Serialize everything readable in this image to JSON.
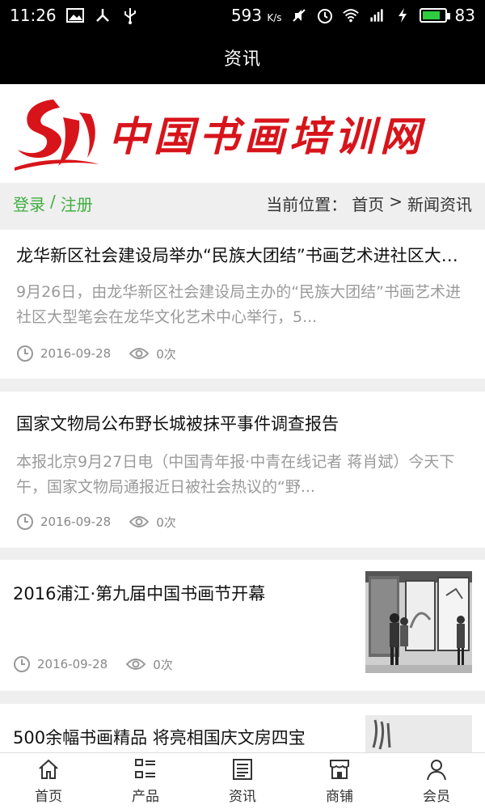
{
  "status_bar": {
    "time": "11:26",
    "network_speed": "593",
    "network_speed_unit": "K/s",
    "battery_level": "83",
    "battery_fraction": 0.83,
    "icons": [
      "image-icon",
      "share-icon",
      "usb-icon",
      "mute-icon",
      "alarm-icon",
      "wifi-icon",
      "signal-4g-icon",
      "charging-icon",
      "battery-icon"
    ]
  },
  "header": {
    "title": "资讯"
  },
  "banner": {
    "title": "中国书画培训网"
  },
  "auth": {
    "login": "登录",
    "separator": "/",
    "register": "注册"
  },
  "breadcrumb": {
    "label": "当前位置：",
    "home": "首页",
    "separator": ">",
    "current": "新闻资讯"
  },
  "articles": [
    {
      "title": "龙华新区社会建设局举办“民族大团结”书画艺术进社区大型笔会",
      "summary": "9月26日，由龙华新区社会建设局主办的“民族大团结”书画艺术进社区大型笔会在龙华文化艺术中心举行，5...",
      "date": "2016-09-28",
      "views": "0次"
    },
    {
      "title": "国家文物局公布野长城被抹平事件调查报告",
      "summary": "本报北京9月27日电（中国青年报·中青在线记者 蒋肖斌）今天下午，国家文物局通报近日被社会热议的“野...",
      "date": "2016-09-28",
      "views": "0次"
    },
    {
      "title": "2016浦江·第九届中国书画节开幕",
      "date": "2016-09-28",
      "views": "0次"
    },
    {
      "title": "500余幅书画精品 将亮相国庆文房四宝"
    }
  ],
  "nav": [
    {
      "label": "首页",
      "icon": "home-icon"
    },
    {
      "label": "产品",
      "icon": "grid-list-icon"
    },
    {
      "label": "资讯",
      "icon": "news-icon"
    },
    {
      "label": "商铺",
      "icon": "shop-icon"
    },
    {
      "label": "会员",
      "icon": "user-icon"
    }
  ]
}
